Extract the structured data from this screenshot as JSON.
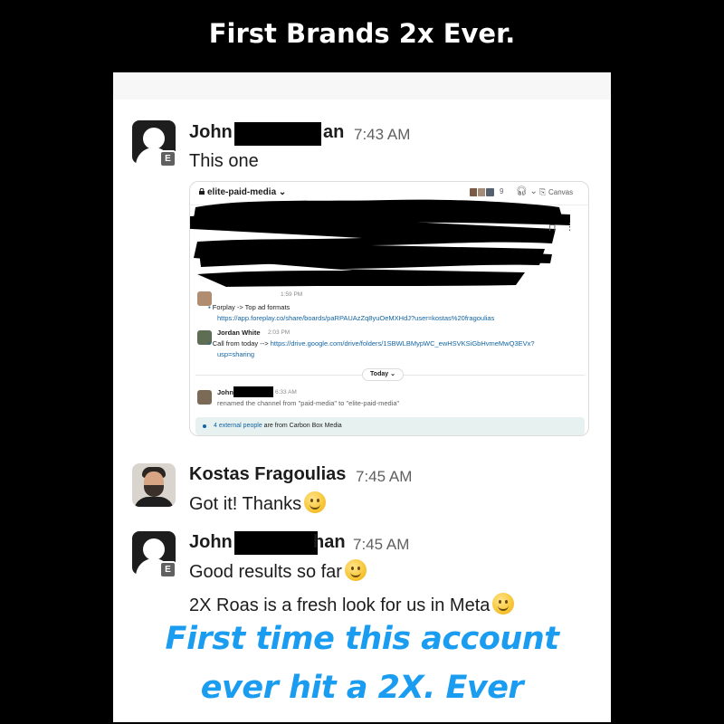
{
  "header": {
    "title": "First Brands 2x Ever."
  },
  "messages": [
    {
      "name_prefix": "John",
      "name_suffix": "an",
      "time": "7:43 AM",
      "text": "This one",
      "badge": "E"
    },
    {
      "name": "Kostas Fragoulias",
      "time": "7:45 AM",
      "text": "Got it! Thanks"
    },
    {
      "name_prefix": "John",
      "name_suffix": "han",
      "time": "7:45 AM",
      "text": "Good results so far",
      "text2": "2X Roas is a fresh look for us in Meta",
      "badge": "E"
    }
  ],
  "embed": {
    "channel": "elite-paid-media",
    "member_count": "9",
    "canvas_label": "Canvas",
    "msg1_time": "1:59 PM",
    "msg1_text": "Forplay -> Top ad formats",
    "msg1_link": "https://app.foreplay.co/share/boards/paRPAUAzZq8yuOeMXHdJ?user=kostas%20fragoulias",
    "msg2_name": "Jordan White",
    "msg2_time": "2:03 PM",
    "msg2_text": "Call from today -->",
    "msg2_link": "https://drive.google.com/drive/folders/1SBWLBMypWC_ewHSVKSiGbHvmeMwQ3EVx?",
    "msg2_link2": "usp=sharing",
    "today_label": "Today",
    "msg3_name": "John T",
    "msg3_time": "6:33 AM",
    "msg3_text": "renamed the channel from \"paid-media\" to \"elite-paid-media\"",
    "footer_link": "4 external people",
    "footer_text": "are from Carbon Box Media"
  },
  "caption": {
    "line1": "First time this account",
    "line2": "ever hit a 2X. Ever"
  },
  "colors": {
    "caption": "#1a9cf0",
    "link": "#1264a3"
  }
}
